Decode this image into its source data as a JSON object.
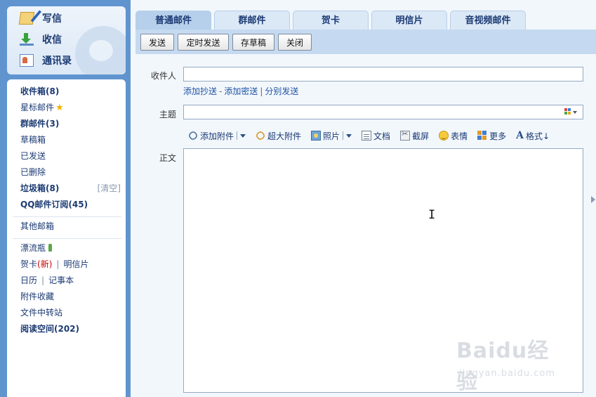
{
  "sidebar": {
    "quick": [
      {
        "label": "写信",
        "icon": "compose-icon"
      },
      {
        "label": "收信",
        "icon": "inbox-download-icon"
      },
      {
        "label": "通讯录",
        "icon": "address-book-icon"
      }
    ],
    "folders": {
      "inbox": "收件箱(8)",
      "starred": "星标邮件",
      "group": "群邮件(3)",
      "drafts": "草稿箱",
      "sent": "已发送",
      "deleted": "已删除",
      "spam": "垃圾箱(8)",
      "spam_clear": "[清空]",
      "subscriptions": "QQ邮件订阅(45)",
      "other_mailbox": "其他邮箱",
      "drift_bottle": "漂流瓶",
      "greeting_card": "贺卡",
      "greeting_card_new": "(新)",
      "postcard": "明信片",
      "calendar": "日历",
      "notebook": "记事本",
      "attachments": "附件收藏",
      "file_transfer": "文件中转站",
      "reading_space": "阅读空间(202)"
    }
  },
  "tabs": [
    "普通邮件",
    "群邮件",
    "贺卡",
    "明信片",
    "音视频邮件"
  ],
  "active_tab": "普通邮件",
  "toolbar": {
    "send": "发送",
    "scheduled_send": "定时发送",
    "save_draft": "存草稿",
    "close": "关闭"
  },
  "compose": {
    "recipient_label": "收件人",
    "recipient_value": "",
    "add_cc": "添加抄送",
    "dash": "-",
    "add_bcc": "添加密送",
    "pipe": "|",
    "separate_send": "分别发送",
    "subject_label": "主题",
    "subject_value": "",
    "body_label": "正文",
    "body_value": ""
  },
  "attach_toolbar": {
    "attach": "添加附件",
    "large_attach": "超大附件",
    "photo": "照片",
    "document": "文档",
    "screenshot": "截屏",
    "emoticon": "表情",
    "more": "更多",
    "format": "格式↓"
  },
  "watermark": {
    "brand": "Baidu经验",
    "url": "jingyan.baidu.com"
  },
  "colors": {
    "sidebar_bg": "#5f94cf",
    "toolbar_bg": "#c5daf0",
    "link": "#1f52a3",
    "new_badge": "#cc0000"
  }
}
